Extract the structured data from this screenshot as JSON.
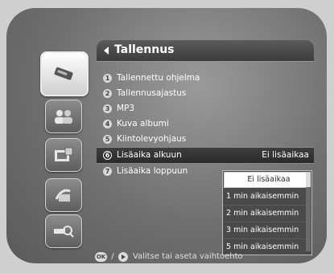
{
  "header": {
    "title": "Tallennus"
  },
  "sidebar": {
    "items": [
      {
        "icon": "recording-icon",
        "active": true
      },
      {
        "icon": "users-icon",
        "active": false
      },
      {
        "icon": "calendar-tv-icon",
        "active": false
      },
      {
        "icon": "satellite-icon",
        "active": false
      },
      {
        "icon": "search-settings-icon",
        "active": false
      }
    ]
  },
  "menu": {
    "items": [
      {
        "num": "1",
        "label": "Tallennettu ohjelma",
        "value": ""
      },
      {
        "num": "2",
        "label": "Tallennusajastus",
        "value": ""
      },
      {
        "num": "3",
        "label": "MP3",
        "value": ""
      },
      {
        "num": "4",
        "label": "Kuva albumi",
        "value": ""
      },
      {
        "num": "5",
        "label": "Kiintolevyohjaus",
        "value": ""
      },
      {
        "num": "6",
        "label": "Lisäaika alkuun",
        "value": "Ei lisäaikaa"
      },
      {
        "num": "7",
        "label": "Lisäaika loppuun",
        "value": ""
      }
    ]
  },
  "dropdown": {
    "options": [
      "Ei lisäaikaa",
      "1 min aikaisemmin",
      "2 min aikaisemmin",
      "3 min aikaisemmin",
      "5 min aikaisemmin"
    ]
  },
  "footer": {
    "ok_label": "OK",
    "separator": "/",
    "hint": "Valitse tai aseta vaihtoehto"
  }
}
